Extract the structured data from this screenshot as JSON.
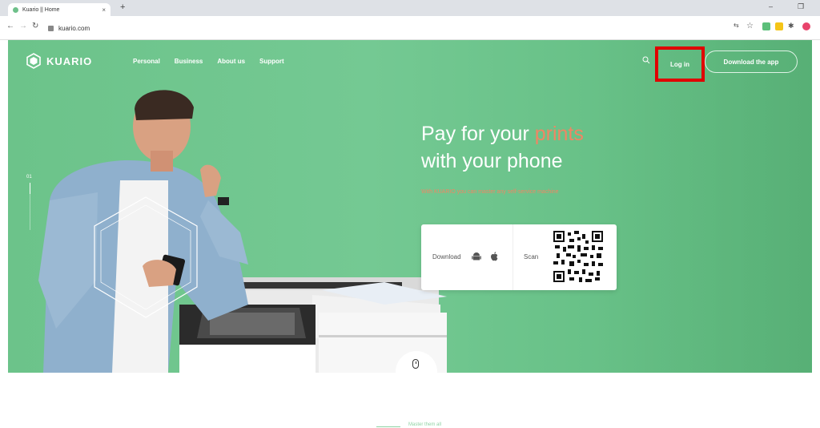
{
  "browser": {
    "tab_title": "Kuario || Home",
    "tab_close": "×",
    "new_tab": "+",
    "url": "kuario.com",
    "minimize": "–",
    "restore": "❐"
  },
  "header": {
    "logo_text": "KUARIO",
    "nav": [
      "Personal",
      "Business",
      "About us",
      "Support"
    ],
    "login_label": "Log in",
    "download_app_label": "Download the app"
  },
  "hero": {
    "slide_number": "01",
    "headline_line1_prefix": "Pay for your ",
    "headline_line1_accent": "prints",
    "headline_line2": "with your phone",
    "subline": "With KUARIO you can master any self-service machine",
    "download_label": "Download",
    "scan_label": "Scan"
  },
  "below": {
    "section_label": "Master them all"
  },
  "colors": {
    "hero_green": "#6cc38a",
    "accent_coral": "#f08664",
    "highlight_red": "#e00000"
  }
}
